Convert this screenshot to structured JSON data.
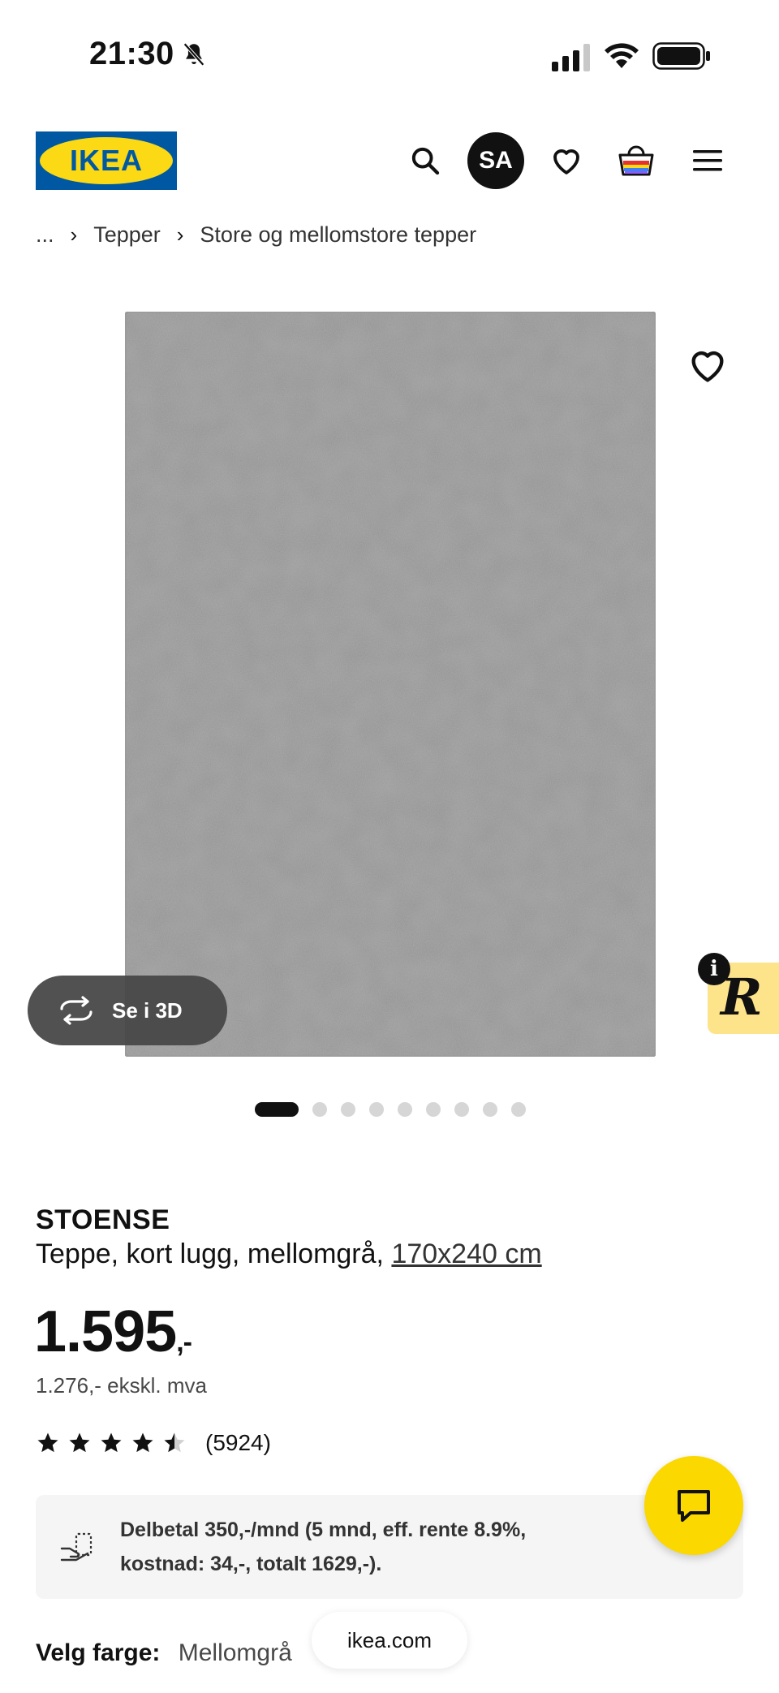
{
  "status_bar": {
    "time": "21:30"
  },
  "header": {
    "logo_text": "IKEA",
    "avatar_initials": "SA"
  },
  "breadcrumb": {
    "ellipsis": "...",
    "items": [
      "Tepper",
      "Store og mellomstore tepper"
    ],
    "separator": "›"
  },
  "gallery": {
    "view_3d_label": "Se i 3D",
    "image_count": 9,
    "active_index": 0,
    "badge_letter": "R",
    "info_symbol": "i"
  },
  "product": {
    "name": "STOENSE",
    "description": "Teppe, kort lugg, mellomgrå,",
    "size": "170x240 cm",
    "price": "1.595",
    "price_suffix": ",-",
    "price_ex_vat": "1.276,- ekskl. mva",
    "rating": 4.5,
    "rating_max": 5,
    "review_count": "(5924)"
  },
  "finance": {
    "line1": "Delbetal 350,-/mnd (5 mnd, eff. rente 8.9%,",
    "line2": "kostnad: 34,-, totalt 1629,-)."
  },
  "color_select": {
    "label": "Velg farge:",
    "value": "Mellomgrå"
  },
  "browser": {
    "url": "ikea.com"
  },
  "colors": {
    "ikea_blue": "#0058a3",
    "ikea_yellow": "#fbd914",
    "chat_yellow": "#fad800",
    "rug_gray": "#8f8f8f"
  }
}
